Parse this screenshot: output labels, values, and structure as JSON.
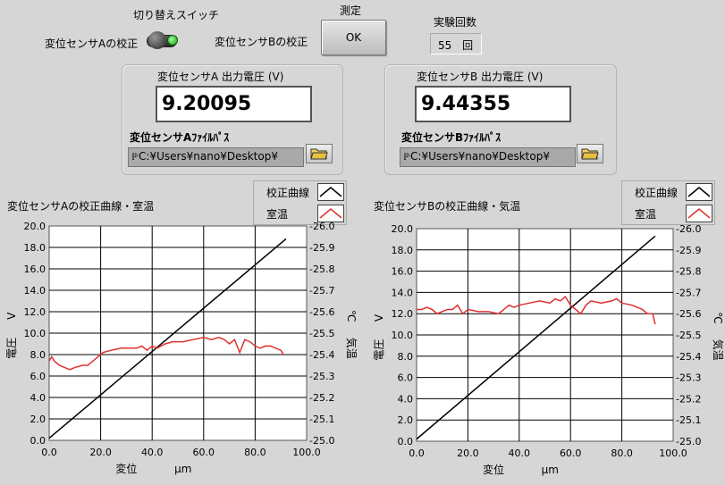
{
  "controls": {
    "switch_title": "切り替えスイッチ",
    "switch_left_label": "変位センサAの校正",
    "switch_right_label": "変位センサBの校正",
    "measure_title": "測定",
    "ok_label": "OK",
    "count_title": "実験回数",
    "count_value": "55",
    "count_unit": "回"
  },
  "sensorA": {
    "voltage_label": "変位センサA 出力電圧 (V)",
    "voltage_value": "9.20095",
    "path_label": "変位センサAﾌｧｲﾙﾊﾟｽ",
    "path_value": "C:¥Users¥nano¥Desktop¥"
  },
  "sensorB": {
    "voltage_label": "変位センサB 出力電圧 (V)",
    "voltage_value": "9.44355",
    "path_label": "変位センサBﾌｧｲﾙﾊﾟｽ",
    "path_value": "C:¥Users¥nano¥Desktop¥"
  },
  "icons": {
    "folder": "folder-open-icon",
    "path": "path-icon"
  },
  "colors": {
    "calibration_line": "#000000",
    "temperature_line": "#e03030"
  },
  "chart_data": [
    {
      "type": "line",
      "title": "変位センサAの校正曲線・室温",
      "xlabel": "変位　μm",
      "ylabel": "電圧　V",
      "y2label": "気温　℃",
      "xlim": [
        0,
        100
      ],
      "ylim": [
        0,
        20
      ],
      "y2lim": [
        25.0,
        26.0
      ],
      "xticks": [
        "0.0",
        "20.0",
        "40.0",
        "60.0",
        "80.0",
        "100.0"
      ],
      "yticks": [
        "0.0",
        "2.0",
        "4.0",
        "6.0",
        "8.0",
        "10.0",
        "12.0",
        "14.0",
        "16.0",
        "18.0",
        "20.0"
      ],
      "y2ticks": [
        "-25.0",
        "-25.1",
        "-25.2",
        "-25.3",
        "-25.4",
        "-25.5",
        "-25.6",
        "-25.7",
        "-25.8",
        "-25.9",
        "-26.0"
      ],
      "grid": true,
      "legend": "top-right",
      "series": [
        {
          "name": "校正曲線",
          "axis": "left",
          "x": [
            0,
            92
          ],
          "y": [
            0.2,
            18.8
          ]
        },
        {
          "name": "室温",
          "axis": "right",
          "x": [
            0,
            1,
            2,
            4,
            6,
            8,
            10,
            13,
            15,
            18,
            21,
            24,
            28,
            31,
            34,
            36,
            38,
            40,
            42,
            45,
            48,
            52,
            56,
            60,
            63,
            66,
            68,
            70,
            72,
            74,
            76,
            78,
            80,
            82,
            84,
            86,
            88,
            90,
            91
          ],
          "y": [
            25.37,
            25.39,
            25.37,
            25.35,
            25.34,
            25.33,
            25.34,
            25.35,
            25.35,
            25.38,
            25.41,
            25.42,
            25.43,
            25.43,
            25.43,
            25.44,
            25.42,
            25.44,
            25.43,
            25.45,
            25.46,
            25.46,
            25.47,
            25.48,
            25.47,
            25.48,
            25.47,
            25.45,
            25.47,
            25.41,
            25.47,
            25.46,
            25.44,
            25.43,
            25.44,
            25.44,
            25.43,
            25.42,
            25.4
          ]
        }
      ]
    },
    {
      "type": "line",
      "title": "変位センサBの校正曲線・気温",
      "xlabel": "変位　μm",
      "ylabel": "電圧　V",
      "y2label": "気温　℃",
      "xlim": [
        0,
        100
      ],
      "ylim": [
        0,
        20
      ],
      "y2lim": [
        25.0,
        26.0
      ],
      "xticks": [
        "0.0",
        "20.0",
        "40.0",
        "60.0",
        "80.0",
        "100.0"
      ],
      "yticks": [
        "0.0",
        "2.0",
        "4.0",
        "6.0",
        "8.0",
        "10.0",
        "12.0",
        "14.0",
        "16.0",
        "18.0",
        "20.0"
      ],
      "y2ticks": [
        "-25.0",
        "-25.1",
        "-25.2",
        "-25.3",
        "-25.4",
        "-25.5",
        "-25.6",
        "-25.7",
        "-25.8",
        "-25.9",
        "-26.0"
      ],
      "grid": true,
      "legend": "top-right",
      "series": [
        {
          "name": "校正曲線",
          "axis": "left",
          "x": [
            0,
            93
          ],
          "y": [
            0.2,
            19.3
          ]
        },
        {
          "name": "室温",
          "axis": "right",
          "x": [
            0,
            2,
            4,
            6,
            8,
            10,
            12,
            14,
            16,
            18,
            20,
            24,
            28,
            32,
            36,
            38,
            40,
            44,
            48,
            52,
            54,
            56,
            58,
            60,
            62,
            64,
            66,
            68,
            72,
            76,
            78,
            80,
            84,
            86,
            88,
            90,
            92,
            93
          ],
          "y": [
            25.62,
            25.62,
            25.63,
            25.62,
            25.6,
            25.61,
            25.62,
            25.62,
            25.64,
            25.6,
            25.62,
            25.61,
            25.61,
            25.6,
            25.64,
            25.63,
            25.64,
            25.65,
            25.66,
            25.65,
            25.67,
            25.66,
            25.68,
            25.64,
            25.62,
            25.6,
            25.64,
            25.66,
            25.65,
            25.66,
            25.67,
            25.65,
            25.64,
            25.63,
            25.62,
            25.6,
            25.6,
            25.55
          ]
        }
      ]
    }
  ]
}
